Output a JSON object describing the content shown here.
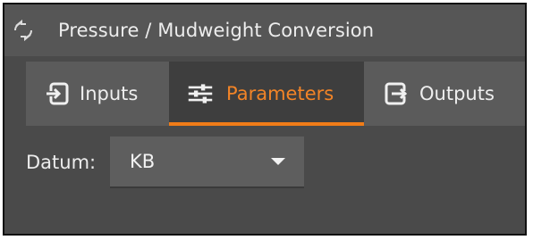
{
  "window": {
    "title": "Pressure / Mudweight Conversion",
    "icon": "link-arrows-icon"
  },
  "tabs": [
    {
      "label": "Inputs",
      "icon": "sign-in-icon",
      "active": false
    },
    {
      "label": "Parameters",
      "icon": "sliders-icon",
      "active": true
    },
    {
      "label": "Outputs",
      "icon": "sign-out-icon",
      "active": false
    }
  ],
  "parameters": {
    "datum_label": "Datum:",
    "datum_value": "KB"
  },
  "colors": {
    "accent": "#f07c18",
    "active_tab_bg": "#3e3e3e",
    "panel_bg": "#4a4a4a",
    "text": "#eeeeee"
  }
}
